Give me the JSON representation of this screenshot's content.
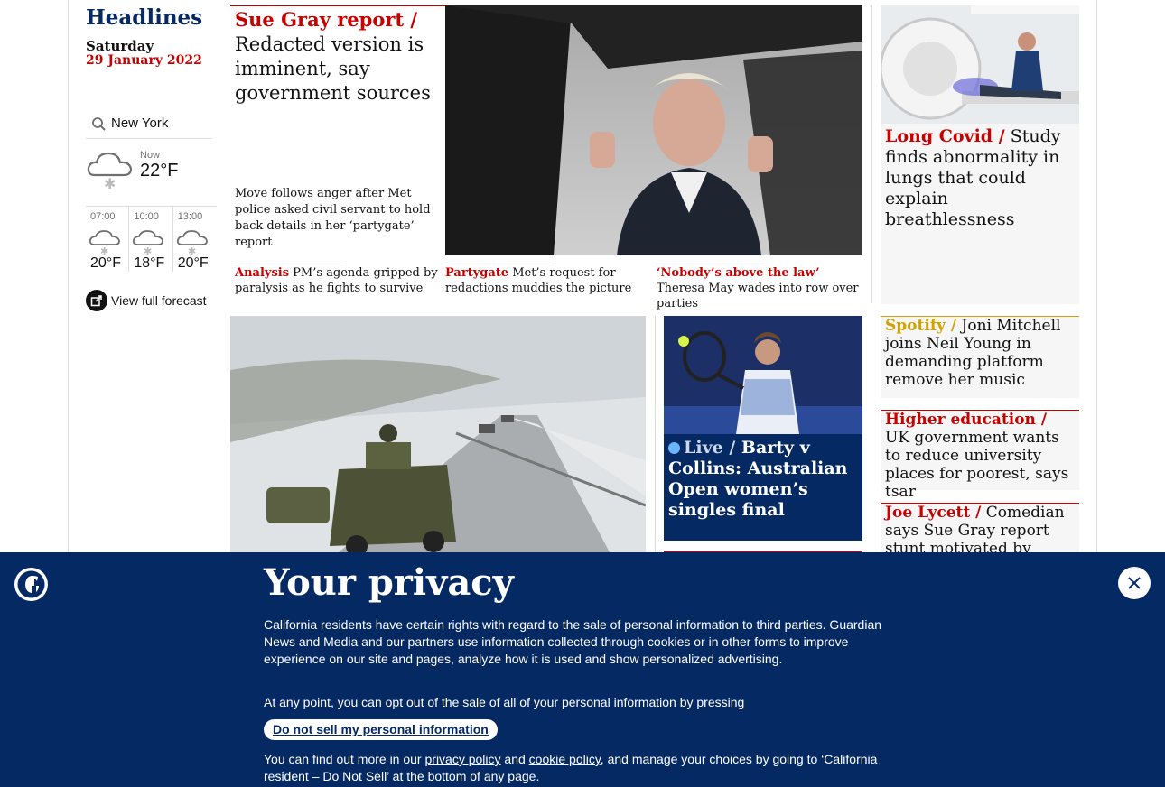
{
  "sidebar": {
    "title": "Headlines",
    "day": "Saturday",
    "date": "29 January 2022",
    "weather": {
      "city": "New York",
      "now_label": "Now",
      "now_temp": "22°F",
      "hourly": [
        {
          "time": "07:00",
          "temp": "20°F"
        },
        {
          "time": "10:00",
          "temp": "18°F"
        },
        {
          "time": "13:00",
          "temp": "20°F"
        }
      ],
      "forecast_link": "View full forecast"
    }
  },
  "lead": {
    "kicker": "Sue Gray report /",
    "headline": "Redacted version is imminent, say government sources",
    "standfirst": "Move follows anger after Met police asked civil servant to hold back details in her ‘partygate’ report",
    "sublinks": [
      {
        "kicker": "Analysis",
        "text": "PM’s agenda gripped by paralysis as he fights to survive"
      },
      {
        "kicker": "Partygate",
        "text": "Met’s request for redactions muddies the picture"
      },
      {
        "kicker": "‘Nobody’s above the law’",
        "text": "Theresa May wades into row over parties"
      }
    ]
  },
  "right_cards": [
    {
      "kicker": "Long Covid /",
      "text": "Study finds abnormality in lungs that could explain breathlessness"
    },
    {
      "kicker": "Spotify /",
      "text": "Joni Mitchell joins Neil Young in demanding platform remove her music"
    },
    {
      "kicker": "Higher education /",
      "text": "UK government wants to reduce university places for poorest, says tsar"
    },
    {
      "kicker": "Joe Lycett /",
      "text": "Comedian says Sue Gray report stunt motivated by anger over"
    }
  ],
  "tennis": {
    "kicker": "Live /",
    "text": "Barty v Collins: Australian Open women’s singles final"
  },
  "privacy": {
    "title": "Your privacy",
    "p1": "California residents have certain rights with regard to the sale of personal information to third parties. Guardian News and Media and our partners use information collected through cookies or in other forms to improve experience on our site and pages, analyze how it is used and show personalized advertising.",
    "p2": "At any point, you can opt out of the sale of all of your personal information by pressing",
    "button": "Do not sell my personal information",
    "p3_a": "You can find out more in our",
    "privacy_link": "privacy policy",
    "and": "and",
    "cookie_link": "cookie policy",
    "p3_b": ", and manage your choices by going to ‘California resident – Do Not Sell’ at the bottom of any page."
  },
  "colors": {
    "brand_blue": "#052962",
    "news_red": "#c70000",
    "culture_gold": "#cfa400"
  }
}
